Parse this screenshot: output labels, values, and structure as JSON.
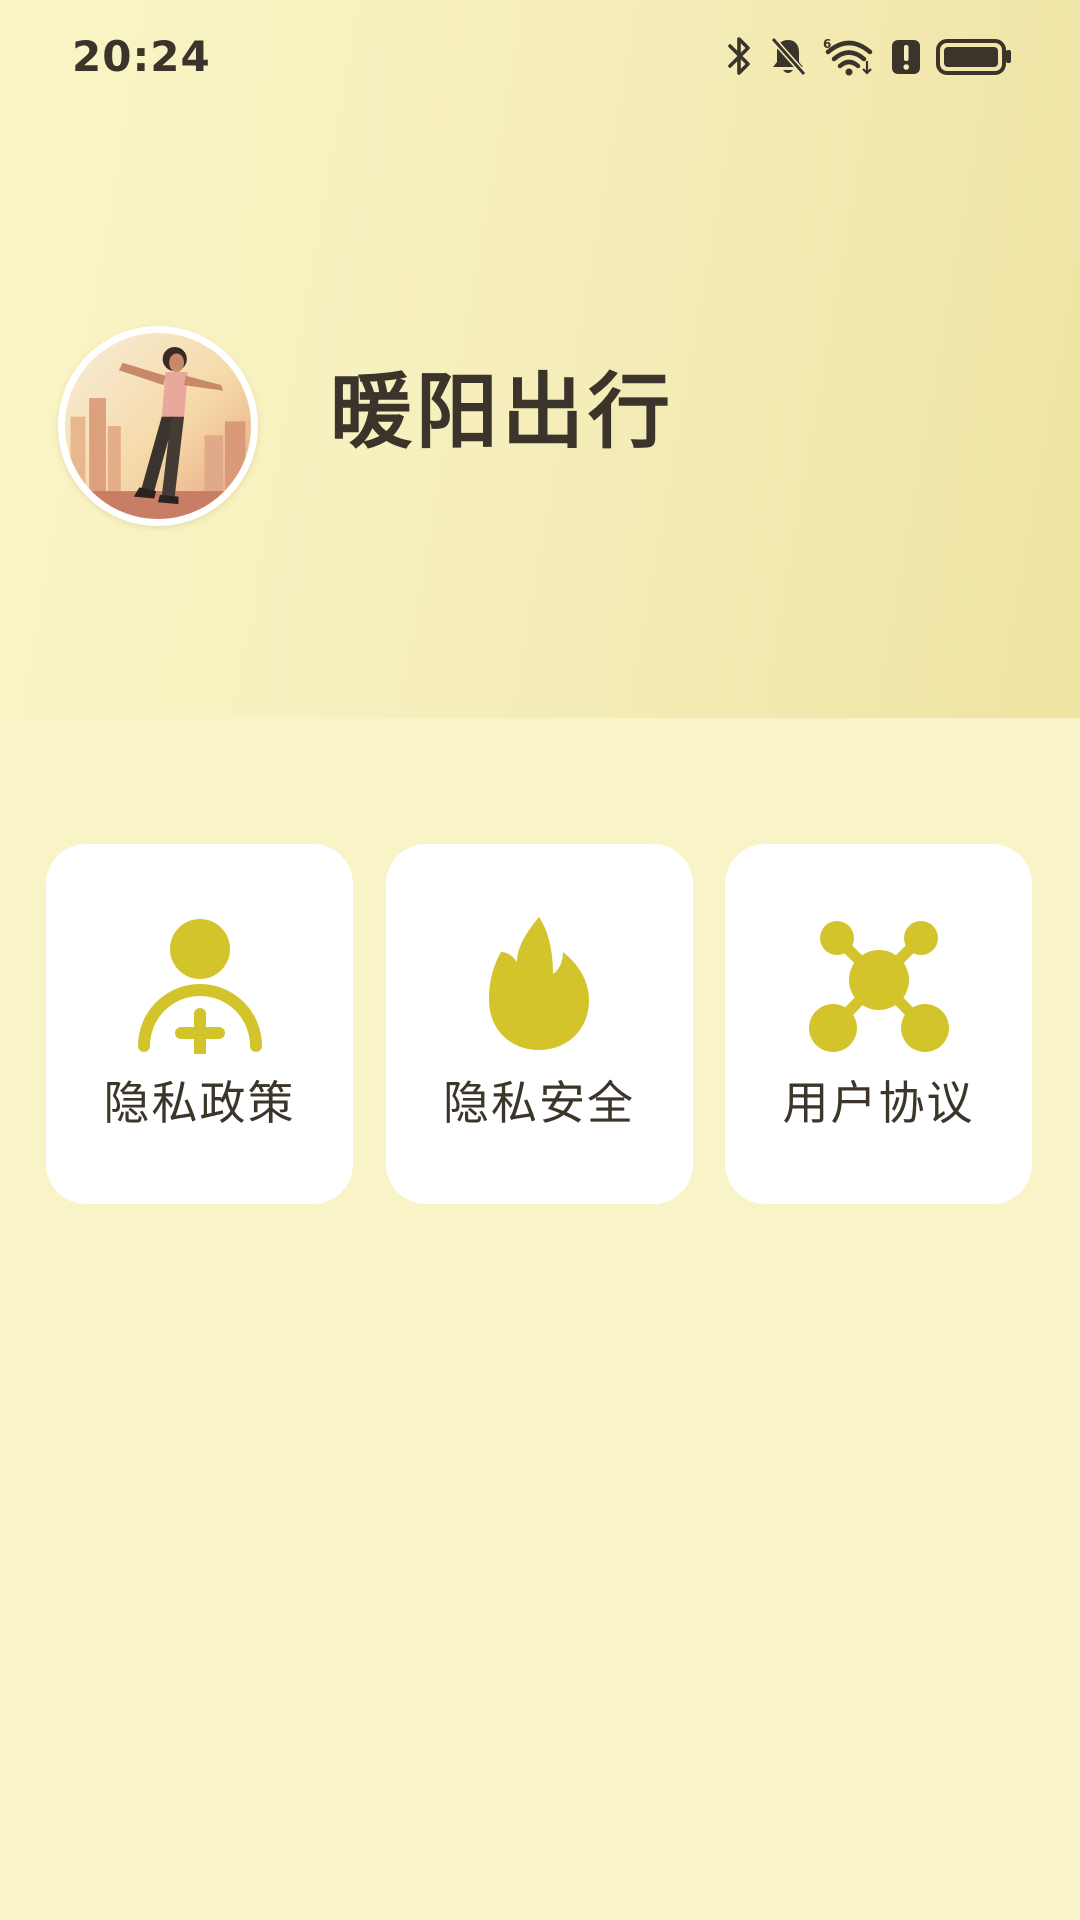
{
  "status_bar": {
    "time": "20:24",
    "icons": [
      "bluetooth-icon",
      "bell-muted-icon",
      "wifi-6-icon",
      "alert-icon",
      "battery-icon"
    ],
    "icon_color": "#3a342a"
  },
  "profile": {
    "avatar_icon": "profile-avatar-image",
    "app_name": "暖阳出行"
  },
  "menu": {
    "accent_color": "#d3c42c",
    "items": [
      {
        "label": "隐私政策",
        "icon": "user-add-icon"
      },
      {
        "label": "隐私安全",
        "icon": "flame-icon"
      },
      {
        "label": "用户协议",
        "icon": "network-nodes-icon"
      }
    ]
  },
  "colors": {
    "background": "#f8f4c8",
    "hero_gradient_start": "#faf5c6",
    "hero_gradient_end": "#efe3a2",
    "card": "#ffffff",
    "text": "#3a342b"
  }
}
